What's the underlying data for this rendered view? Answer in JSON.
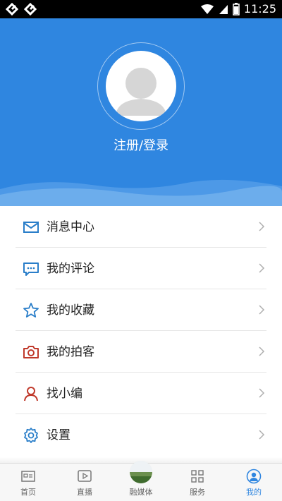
{
  "status_bar": {
    "time": "11:25"
  },
  "header": {
    "login_label": "注册/登录"
  },
  "menu": {
    "items": [
      {
        "label": "消息中心",
        "icon": "envelope-icon"
      },
      {
        "label": "我的评论",
        "icon": "comment-bubble-icon"
      },
      {
        "label": "我的收藏",
        "icon": "star-icon"
      },
      {
        "label": "我的拍客",
        "icon": "camera-icon"
      },
      {
        "label": "找小编",
        "icon": "person-icon"
      },
      {
        "label": "设置",
        "icon": "gear-icon"
      }
    ]
  },
  "bottom_nav": {
    "items": [
      {
        "label": "首页",
        "icon": "news-icon"
      },
      {
        "label": "直播",
        "icon": "play-icon"
      },
      {
        "label": "融媒体",
        "icon": "media-thumbnail"
      },
      {
        "label": "服务",
        "icon": "grid-icon"
      },
      {
        "label": "我的",
        "icon": "profile-icon",
        "active": true
      }
    ]
  },
  "colors": {
    "brand_blue": "#2f86e0",
    "icon_blue": "#2a7ec9",
    "icon_red": "#c0392b",
    "text_dark": "#222222"
  }
}
